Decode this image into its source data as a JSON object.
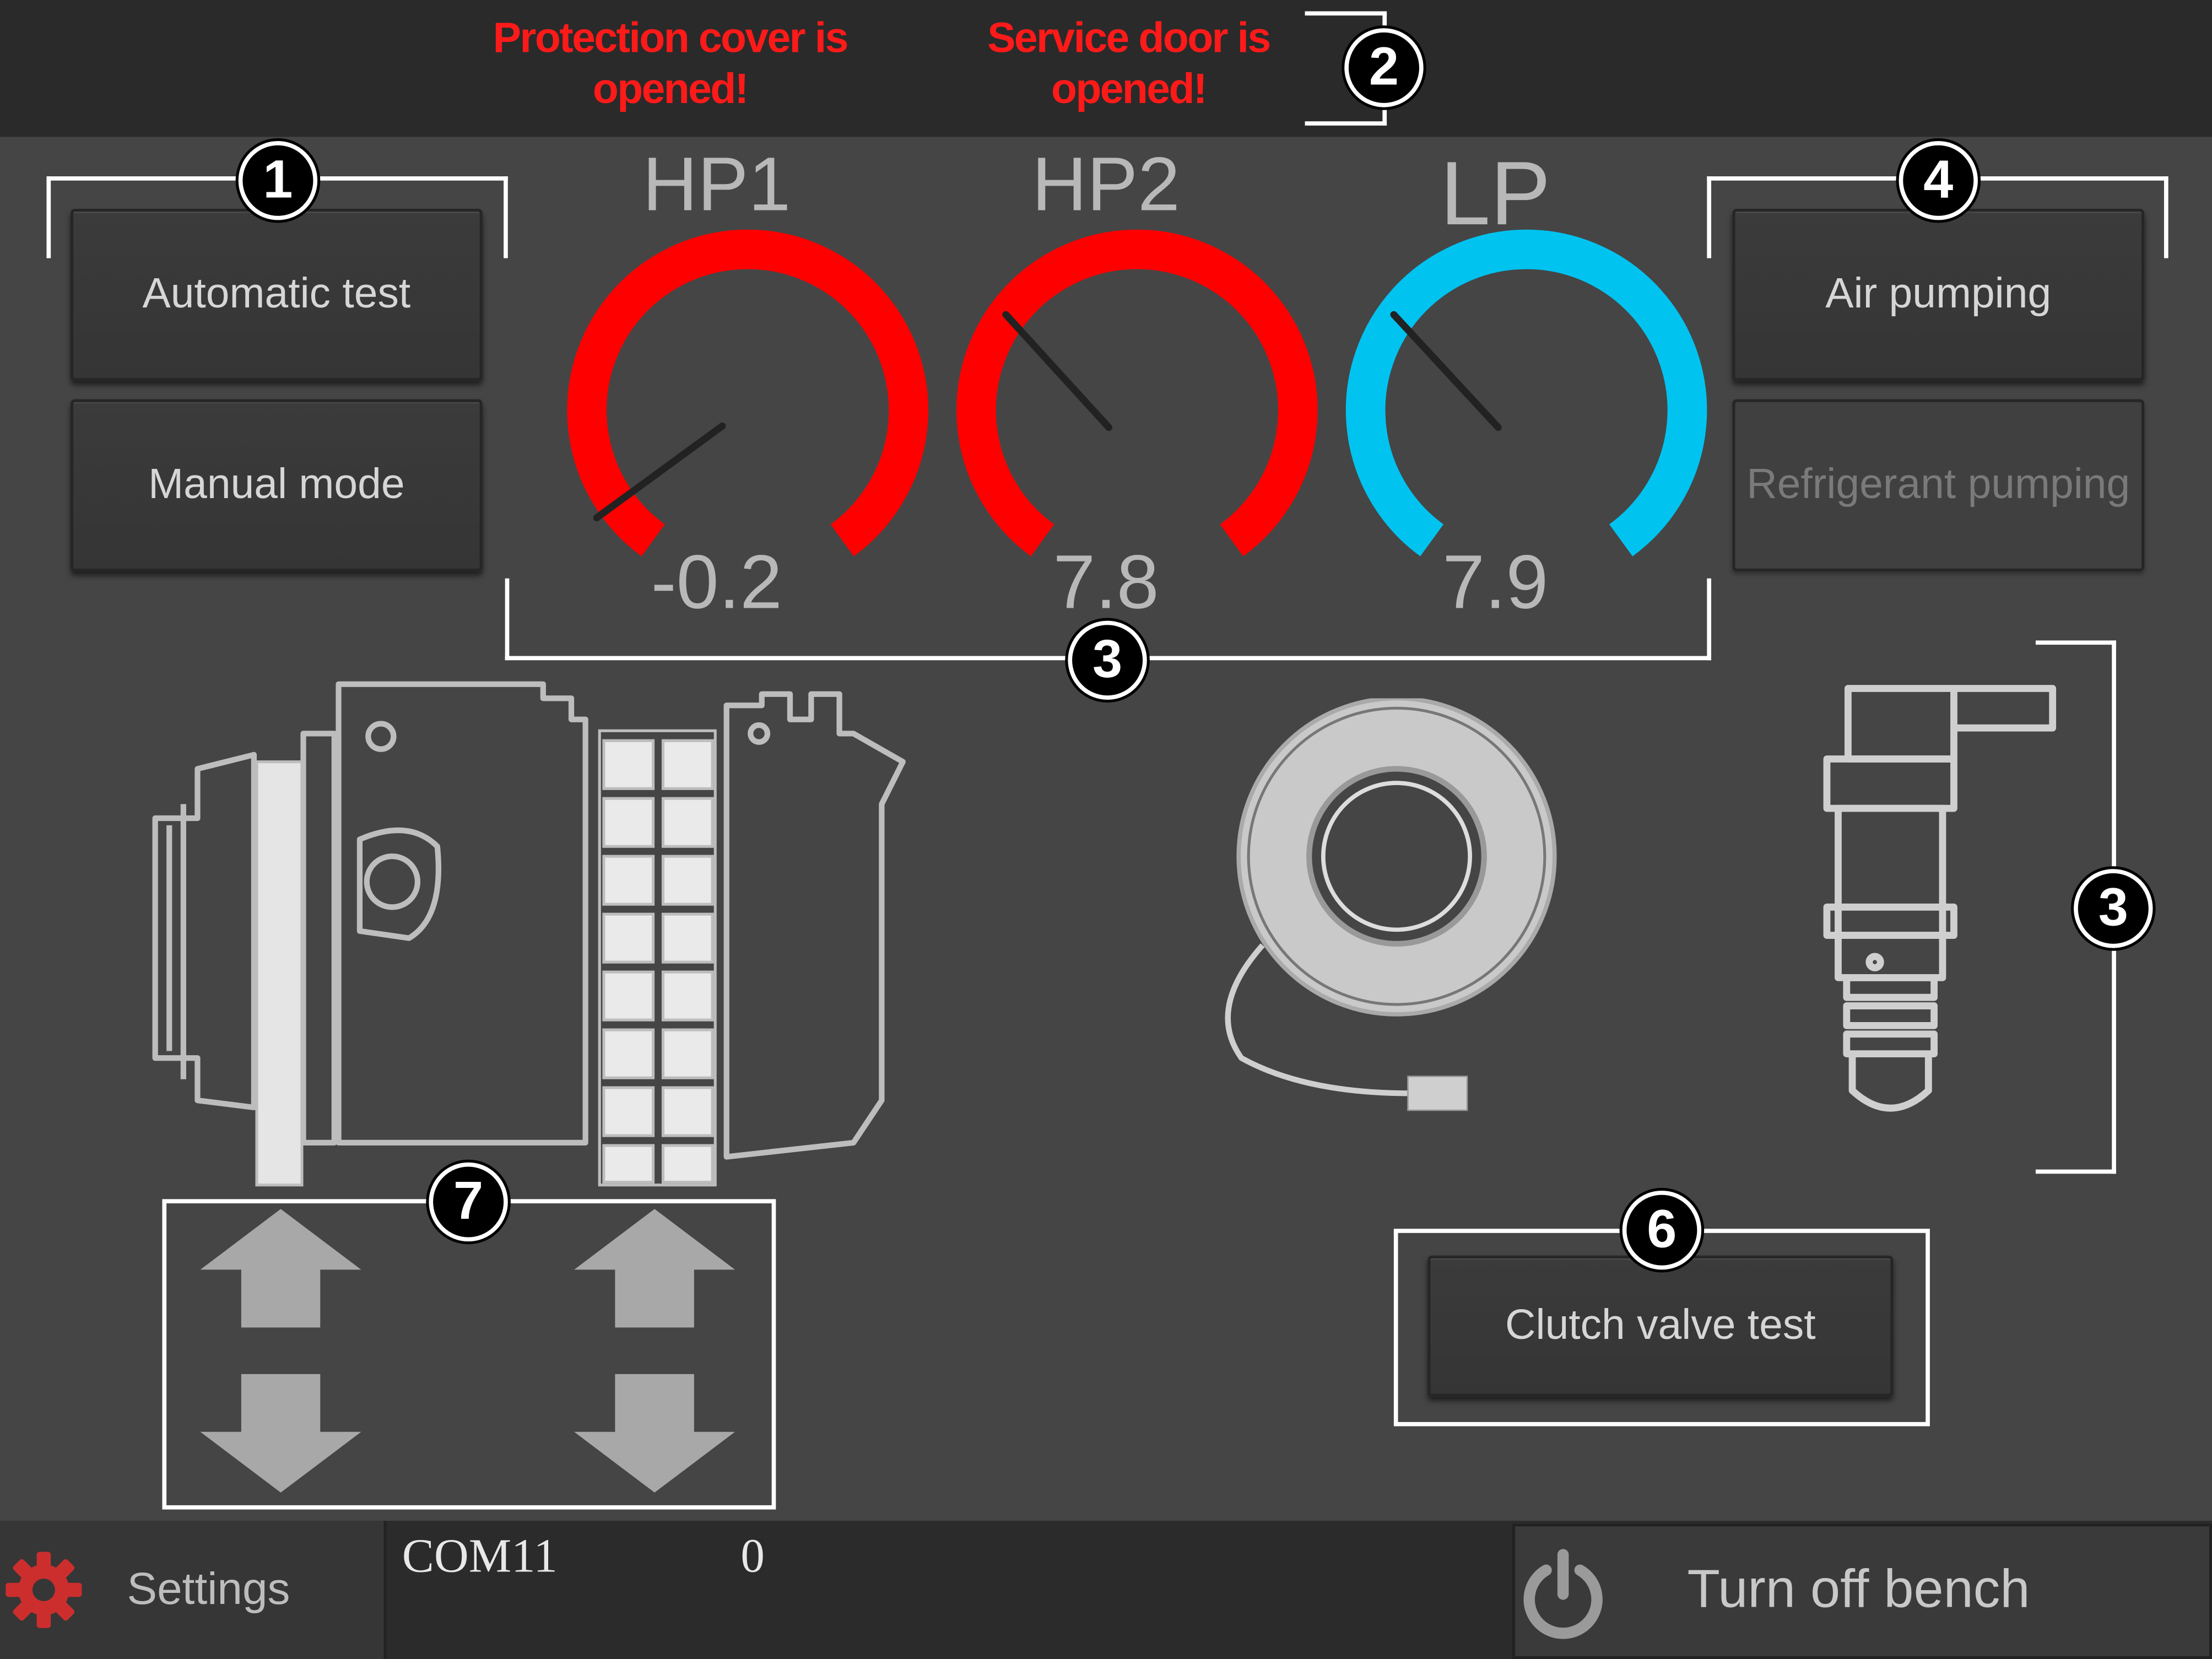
{
  "warnings": {
    "protection_cover": "Protection cover is opened!",
    "service_door": "Service door is opened!"
  },
  "mode_buttons": {
    "automatic_test": "Automatic test",
    "manual_mode": "Manual mode"
  },
  "pump_buttons": {
    "air_pumping": "Air pumping",
    "refrigerant_pumping": "Refrigerant pumping"
  },
  "gauges": [
    {
      "label": "HP1",
      "value": "-0.2",
      "color": "#ff0000"
    },
    {
      "label": "HP2",
      "value": "7.8",
      "color": "#ff0000"
    },
    {
      "label": "LP",
      "value": "7.9",
      "color": "#00c3f0"
    }
  ],
  "clutch_button": "Clutch valve test",
  "callouts": {
    "c1": "1",
    "c2": "2",
    "c3a": "3",
    "c3b": "3",
    "c4": "4",
    "c6": "6",
    "c7": "7"
  },
  "footer": {
    "settings_label": "Settings",
    "port": "COM11",
    "counter": "0",
    "turn_off_label": "Turn off bench"
  },
  "icons": {
    "settings": "gear-icon",
    "power": "power-icon",
    "arrows": [
      "arrow-up-icon",
      "arrow-down-icon"
    ]
  },
  "colors": {
    "warning": "#ff1a1a",
    "high_pressure": "#ff0000",
    "low_pressure": "#00c3f0",
    "settings_gear": "#cc2e2e"
  }
}
